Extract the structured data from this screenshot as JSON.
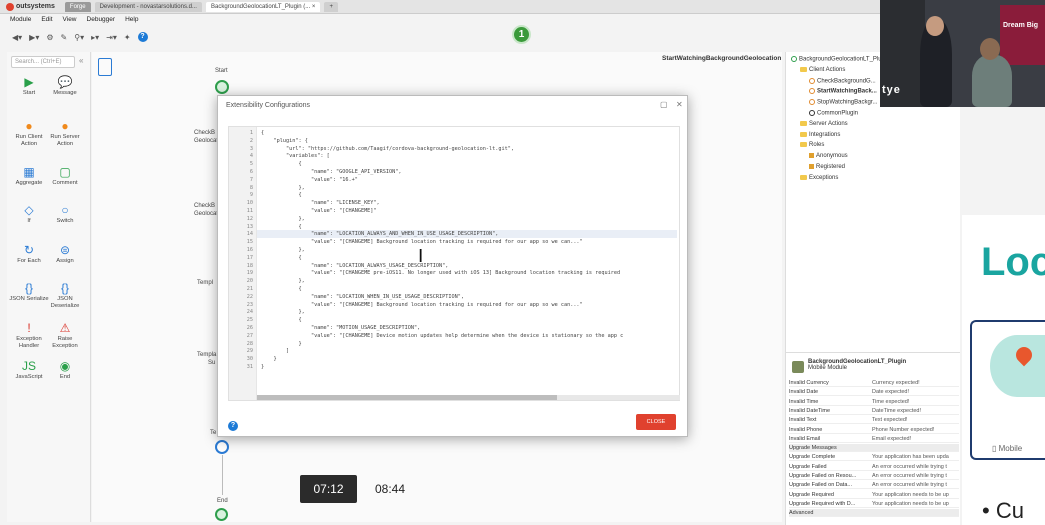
{
  "brand": "outsystems",
  "tabs": [
    {
      "label": "Forge"
    },
    {
      "label": "Development - novastarsolutions.d..."
    },
    {
      "label": "BackgroundGeolocationLT_Plugin (... ×"
    }
  ],
  "menu": [
    "Module",
    "Edit",
    "View",
    "Debugger",
    "Help"
  ],
  "step_badge": "1",
  "toolbox": {
    "search_placeholder": "Search... (Ctrl+E)",
    "tools": [
      {
        "label": "Start",
        "glyph": "▶"
      },
      {
        "label": "Message",
        "glyph": "💬"
      },
      {
        "label": "Run Client Action",
        "glyph": "●"
      },
      {
        "label": "Run Server Action",
        "glyph": "●"
      },
      {
        "label": "Aggregate",
        "glyph": "▦"
      },
      {
        "label": "Comment",
        "glyph": "▢"
      },
      {
        "label": "If",
        "glyph": "◇"
      },
      {
        "label": "Switch",
        "glyph": "○"
      },
      {
        "label": "For Each",
        "glyph": "↻"
      },
      {
        "label": "Assign",
        "glyph": "⊜"
      },
      {
        "label": "JSON Serialize",
        "glyph": "{}"
      },
      {
        "label": "JSON Deserialize",
        "glyph": "{}"
      },
      {
        "label": "Exception Handler",
        "glyph": "!"
      },
      {
        "label": "Raise Exception",
        "glyph": "⚠"
      },
      {
        "label": "JavaScript",
        "glyph": "JS"
      },
      {
        "label": "End",
        "glyph": "◉"
      }
    ]
  },
  "canvas": {
    "action_name": "StartWatchingBackgroundGeolocation",
    "start_label": "Start",
    "end_label": "End",
    "side_labels": [
      "CheckB",
      "Geolocat",
      "CheckB",
      "Geolocat",
      "Templ",
      "Templa",
      "Su",
      "Te"
    ]
  },
  "dialog": {
    "title": "Extensibility Configurations",
    "close_label": "CLOSE",
    "code_lines": [
      "{",
      "    \"plugin\": {",
      "        \"url\": \"https://github.com/Taagif/cordova-background-geolocation-lt.git\",",
      "        \"variables\": [",
      "            {",
      "                \"name\": \"GOOGLE_API_VERSION\",",
      "                \"value\": \"16.+\"",
      "            },",
      "            {",
      "                \"name\": \"LICENSE_KEY\",",
      "                \"value\": \"[CHANGEME]\"",
      "            },",
      "            {",
      "                \"name\": \"LOCATION_ALWAYS_AND_WHEN_IN_USE_USAGE_DESCRIPTION\",",
      "                \"value\": \"[CHANGEME] Background location tracking is required for our app so we can...\"",
      "            },",
      "            {",
      "                \"name\": \"LOCATION_ALWAYS_USAGE_DESCRIPTION\",",
      "                \"value\": \"[CHANGEME pre-iOS11. No longer used with iOS 13] Background location tracking is required",
      "            },",
      "            {",
      "                \"name\": \"LOCATION_WHEN_IN_USE_USAGE_DESCRIPTION\",",
      "                \"value\": \"[CHANGEME] Background location tracking is required for our app so we can...\"",
      "            },",
      "            {",
      "                \"name\": \"MOTION_USAGE_DESCRIPTION\",",
      "                \"value\": \"[CHANGEME] Device motion updates help determine when the device is stationary so the app c",
      "            }",
      "        ]",
      "    }",
      "}"
    ],
    "highlighted_line": 14
  },
  "tree": {
    "items": [
      {
        "label": "BackgroundGeolocationLT_Plugin",
        "kind": "root",
        "indent": 0
      },
      {
        "label": "Client Actions",
        "kind": "folder",
        "indent": 1
      },
      {
        "label": "CheckBackgroundG...",
        "kind": "action",
        "indent": 2
      },
      {
        "label": "StartWatchingBack...",
        "kind": "action",
        "indent": 2,
        "bold": true
      },
      {
        "label": "StopWatchingBackgr...",
        "kind": "action",
        "indent": 2
      },
      {
        "label": "CommonPlugin",
        "kind": "plugin",
        "indent": 2
      },
      {
        "label": "Server Actions",
        "kind": "folder",
        "indent": 1
      },
      {
        "label": "Integrations",
        "kind": "folder",
        "indent": 1
      },
      {
        "label": "Roles",
        "kind": "folder",
        "indent": 1
      },
      {
        "label": "Anonymous",
        "kind": "role",
        "indent": 2
      },
      {
        "label": "Registered",
        "kind": "role",
        "indent": 2
      },
      {
        "label": "Exceptions",
        "kind": "folder",
        "indent": 1
      }
    ]
  },
  "properties": {
    "title": "BackgroundGeolocationLT_Plugin",
    "subtitle": "Mobile Module",
    "rows": [
      {
        "k": "Invalid Currency",
        "v": "Currency expected!"
      },
      {
        "k": "Invalid Date",
        "v": "Date expected!"
      },
      {
        "k": "Invalid Time",
        "v": "Time expected!"
      },
      {
        "k": "Invalid DateTime",
        "v": "DateTime expected!"
      },
      {
        "k": "Invalid Text",
        "v": "Text expected!"
      },
      {
        "k": "Invalid Phone",
        "v": "Phone Number expected!"
      },
      {
        "k": "Invalid Email",
        "v": "Email expected!"
      },
      {
        "k": "Upgrade Messages",
        "v": "",
        "section": true
      },
      {
        "k": "Upgrade Complete",
        "v": "Your application has been upda"
      },
      {
        "k": "Upgrade Failed",
        "v": "An error occurred while trying t"
      },
      {
        "k": "Upgrade Failed on Resou...",
        "v": "An error occurred while trying t"
      },
      {
        "k": "Upgrade Failed on Data...",
        "v": "An error occurred while trying t"
      },
      {
        "k": "Upgrade Required",
        "v": "Your application needs to be up"
      },
      {
        "k": "Upgrade Required with D...",
        "v": "Your application needs to be up"
      },
      {
        "k": "Advanced",
        "v": "",
        "section": true
      }
    ]
  },
  "video": {
    "overlay_text": "tye",
    "banner_text": "Dream Big"
  },
  "slide": {
    "title": "Loc",
    "mobile_label": "Mobile",
    "bullet": "• Cu"
  },
  "timers": {
    "current": "07:12",
    "end": "08:44"
  },
  "colors": {
    "accent_red": "#e0412e",
    "accent_green": "#2e9e4c",
    "slide_teal": "#1aa5a0",
    "help_blue": "#1c7ad6"
  }
}
